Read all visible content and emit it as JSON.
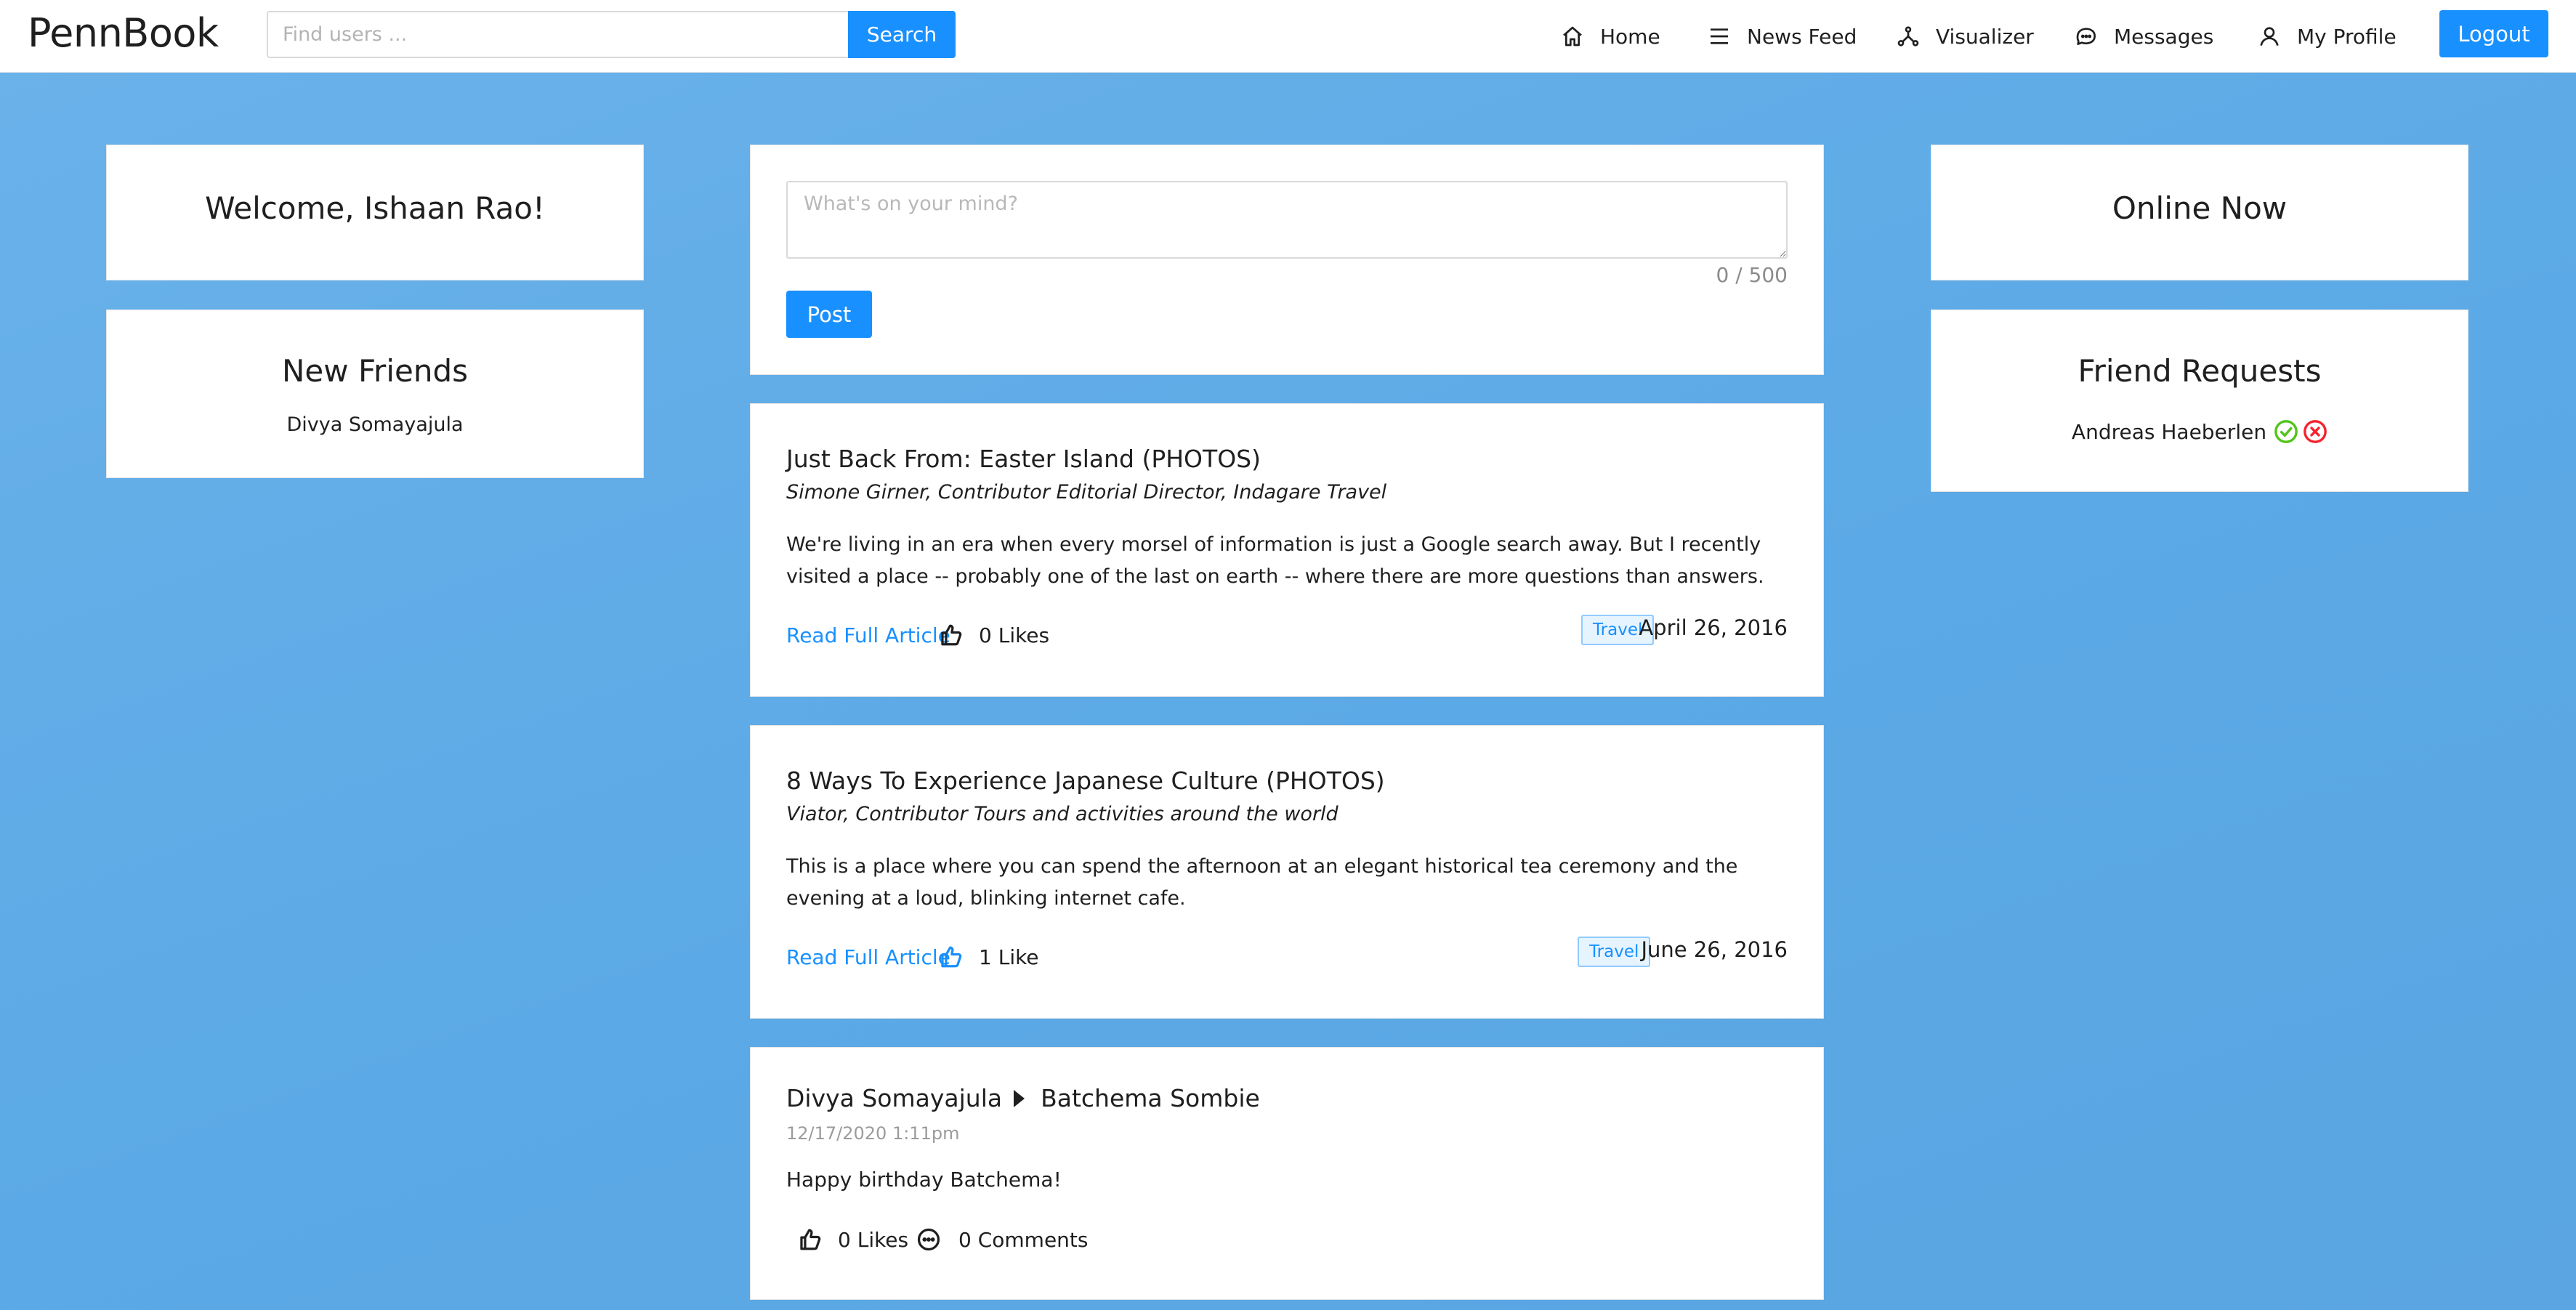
{
  "header": {
    "logo": "PennBook",
    "search_placeholder": "Find users ...",
    "search_label": "Search",
    "nav": [
      {
        "label": "Home",
        "icon": "home-icon"
      },
      {
        "label": "News Feed",
        "icon": "menu-icon"
      },
      {
        "label": "Visualizer",
        "icon": "network-icon"
      },
      {
        "label": "Messages",
        "icon": "chat-icon"
      },
      {
        "label": "My Profile",
        "icon": "user-icon"
      }
    ],
    "logout_label": "Logout"
  },
  "left": {
    "welcome": "Welcome, Ishaan Rao!",
    "new_friends_title": "New Friends",
    "new_friends": [
      "Divya Somayajula"
    ]
  },
  "composer": {
    "placeholder": "What's on your mind?",
    "value": "",
    "char_count": "0 / 500",
    "post_label": "Post"
  },
  "posts": [
    {
      "title": "Just Back From: Easter Island (PHOTOS)",
      "author": "Simone Girner, Contributor Editorial Director, Indagare Travel",
      "body": "We're living in an era when every morsel of information is just a Google search away. But I recently visited a place -- probably one of the last on earth -- where there are more questions than answers.",
      "read_label": "Read Full Article",
      "likes": "0 Likes",
      "liked": false,
      "tag": "Travel",
      "date": "April 26, 2016"
    },
    {
      "title": "8 Ways To Experience Japanese Culture (PHOTOS)",
      "author": "Viator, Contributor Tours and activities around the world",
      "body": "This is a place where you can spend the afternoon at an elegant historical tea ceremony and the evening at a loud, blinking internet cafe.",
      "read_label": "Read Full Article",
      "likes": "1 Like",
      "liked": true,
      "tag": "Travel",
      "date": "June 26, 2016"
    }
  ],
  "wall_post": {
    "from": "Divya Somayajula",
    "to": "Batchema Sombie",
    "time": "12/17/2020 1:11pm",
    "body": "Happy birthday Batchema!",
    "likes": "0 Likes",
    "comments": "0 Comments"
  },
  "right": {
    "online_title": "Online Now",
    "requests_title": "Friend Requests",
    "requests": [
      {
        "name": "Andreas Haeberlen"
      }
    ]
  },
  "colors": {
    "accent": "#1890ff",
    "background": "#5ba9e6",
    "accept": "#52c41a",
    "reject": "#f5222d",
    "tag_bg": "#e6f4ff"
  }
}
